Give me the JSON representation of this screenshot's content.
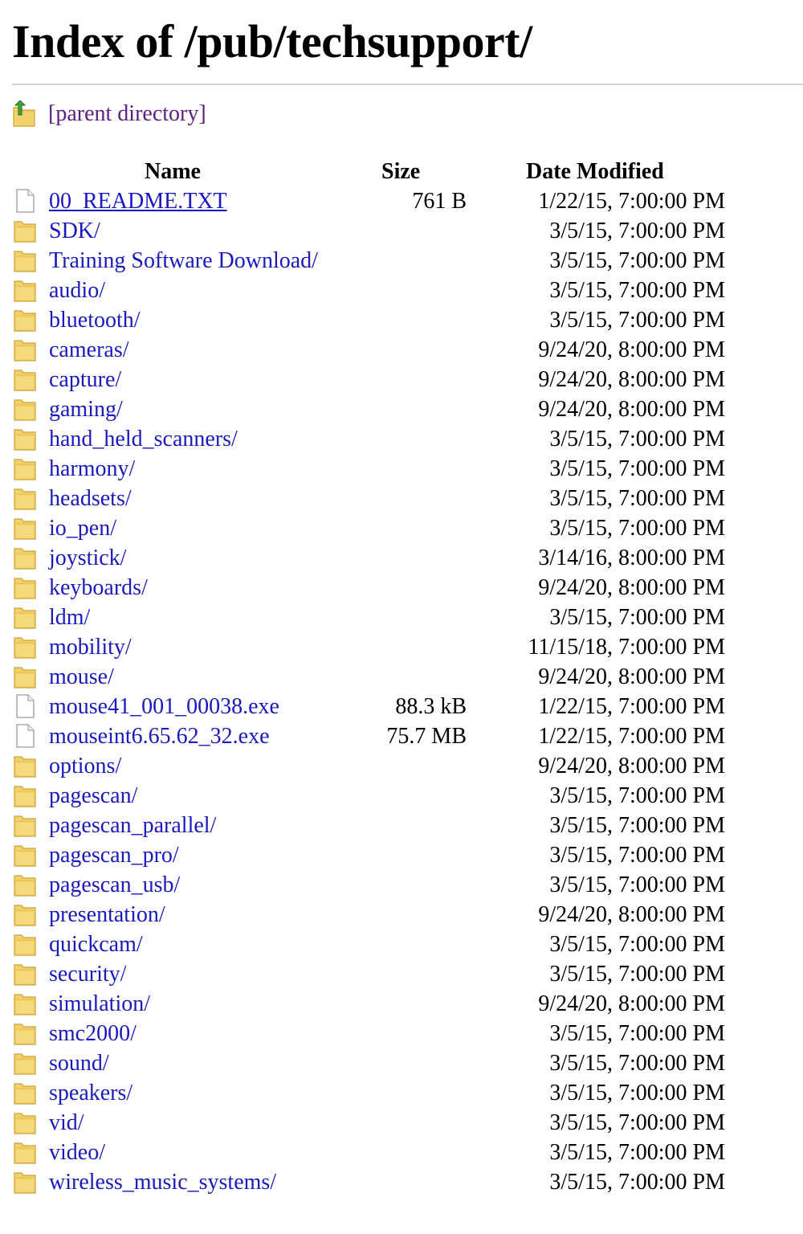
{
  "page": {
    "title": "Index of /pub/techsupport/",
    "parent_link_label": "[parent directory]",
    "parent_icon": "up-arrow-folder-icon"
  },
  "colors": {
    "link": "#1a19c0",
    "visited_link": "#5a1f86",
    "folder": "#f3d26a",
    "rule": "#cfcfcf"
  },
  "table": {
    "headers": {
      "name": "Name",
      "size": "Size",
      "date": "Date Modified"
    },
    "rows": [
      {
        "name": "00_README.TXT",
        "size": "761 B",
        "date": "1/22/15, 7:00:00 PM",
        "type": "file",
        "icon": "file-icon",
        "underline": true
      },
      {
        "name": "SDK/",
        "size": "",
        "date": "3/5/15, 7:00:00 PM",
        "type": "folder",
        "icon": "folder-icon"
      },
      {
        "name": "Training Software Download/",
        "size": "",
        "date": "3/5/15, 7:00:00 PM",
        "type": "folder",
        "icon": "folder-icon"
      },
      {
        "name": "audio/",
        "size": "",
        "date": "3/5/15, 7:00:00 PM",
        "type": "folder",
        "icon": "folder-icon"
      },
      {
        "name": "bluetooth/",
        "size": "",
        "date": "3/5/15, 7:00:00 PM",
        "type": "folder",
        "icon": "folder-icon"
      },
      {
        "name": "cameras/",
        "size": "",
        "date": "9/24/20, 8:00:00 PM",
        "type": "folder",
        "icon": "folder-icon"
      },
      {
        "name": "capture/",
        "size": "",
        "date": "9/24/20, 8:00:00 PM",
        "type": "folder",
        "icon": "folder-icon"
      },
      {
        "name": "gaming/",
        "size": "",
        "date": "9/24/20, 8:00:00 PM",
        "type": "folder",
        "icon": "folder-icon"
      },
      {
        "name": "hand_held_scanners/",
        "size": "",
        "date": "3/5/15, 7:00:00 PM",
        "type": "folder",
        "icon": "folder-icon"
      },
      {
        "name": "harmony/",
        "size": "",
        "date": "3/5/15, 7:00:00 PM",
        "type": "folder",
        "icon": "folder-icon"
      },
      {
        "name": "headsets/",
        "size": "",
        "date": "3/5/15, 7:00:00 PM",
        "type": "folder",
        "icon": "folder-icon"
      },
      {
        "name": "io_pen/",
        "size": "",
        "date": "3/5/15, 7:00:00 PM",
        "type": "folder",
        "icon": "folder-icon"
      },
      {
        "name": "joystick/",
        "size": "",
        "date": "3/14/16, 8:00:00 PM",
        "type": "folder",
        "icon": "folder-icon"
      },
      {
        "name": "keyboards/",
        "size": "",
        "date": "9/24/20, 8:00:00 PM",
        "type": "folder",
        "icon": "folder-icon"
      },
      {
        "name": "ldm/",
        "size": "",
        "date": "3/5/15, 7:00:00 PM",
        "type": "folder",
        "icon": "folder-icon"
      },
      {
        "name": "mobility/",
        "size": "",
        "date": "11/15/18, 7:00:00 PM",
        "type": "folder",
        "icon": "folder-icon"
      },
      {
        "name": "mouse/",
        "size": "",
        "date": "9/24/20, 8:00:00 PM",
        "type": "folder",
        "icon": "folder-icon"
      },
      {
        "name": "mouse41_001_00038.exe",
        "size": "88.3 kB",
        "date": "1/22/15, 7:00:00 PM",
        "type": "file",
        "icon": "file-icon"
      },
      {
        "name": "mouseint6.65.62_32.exe",
        "size": "75.7 MB",
        "date": "1/22/15, 7:00:00 PM",
        "type": "file",
        "icon": "file-icon"
      },
      {
        "name": "options/",
        "size": "",
        "date": "9/24/20, 8:00:00 PM",
        "type": "folder",
        "icon": "folder-icon"
      },
      {
        "name": "pagescan/",
        "size": "",
        "date": "3/5/15, 7:00:00 PM",
        "type": "folder",
        "icon": "folder-icon"
      },
      {
        "name": "pagescan_parallel/",
        "size": "",
        "date": "3/5/15, 7:00:00 PM",
        "type": "folder",
        "icon": "folder-icon"
      },
      {
        "name": "pagescan_pro/",
        "size": "",
        "date": "3/5/15, 7:00:00 PM",
        "type": "folder",
        "icon": "folder-icon"
      },
      {
        "name": "pagescan_usb/",
        "size": "",
        "date": "3/5/15, 7:00:00 PM",
        "type": "folder",
        "icon": "folder-icon"
      },
      {
        "name": "presentation/",
        "size": "",
        "date": "9/24/20, 8:00:00 PM",
        "type": "folder",
        "icon": "folder-icon"
      },
      {
        "name": "quickcam/",
        "size": "",
        "date": "3/5/15, 7:00:00 PM",
        "type": "folder",
        "icon": "folder-icon"
      },
      {
        "name": "security/",
        "size": "",
        "date": "3/5/15, 7:00:00 PM",
        "type": "folder",
        "icon": "folder-icon"
      },
      {
        "name": "simulation/",
        "size": "",
        "date": "9/24/20, 8:00:00 PM",
        "type": "folder",
        "icon": "folder-icon"
      },
      {
        "name": "smc2000/",
        "size": "",
        "date": "3/5/15, 7:00:00 PM",
        "type": "folder",
        "icon": "folder-icon"
      },
      {
        "name": "sound/",
        "size": "",
        "date": "3/5/15, 7:00:00 PM",
        "type": "folder",
        "icon": "folder-icon"
      },
      {
        "name": "speakers/",
        "size": "",
        "date": "3/5/15, 7:00:00 PM",
        "type": "folder",
        "icon": "folder-icon"
      },
      {
        "name": "vid/",
        "size": "",
        "date": "3/5/15, 7:00:00 PM",
        "type": "folder",
        "icon": "folder-icon"
      },
      {
        "name": "video/",
        "size": "",
        "date": "3/5/15, 7:00:00 PM",
        "type": "folder",
        "icon": "folder-icon"
      },
      {
        "name": "wireless_music_systems/",
        "size": "",
        "date": "3/5/15, 7:00:00 PM",
        "type": "folder",
        "icon": "folder-icon"
      }
    ]
  }
}
